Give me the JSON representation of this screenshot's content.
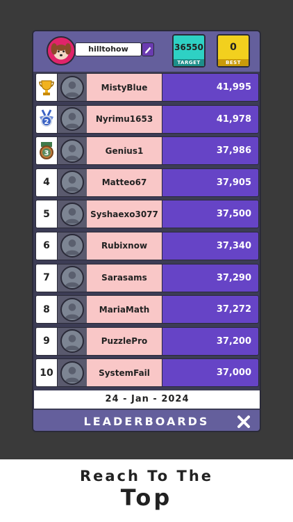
{
  "header": {
    "username": "hilltohow",
    "target_value": "36550",
    "target_label": "TARGET",
    "best_value": "0",
    "best_label": "BEST"
  },
  "leaderboard": [
    {
      "rank": "1",
      "rank_icon": "trophy-icon",
      "name": "MistyBlue",
      "score": "41,995"
    },
    {
      "rank": "2",
      "rank_icon": "silver-medal-icon",
      "name": "Nyrimu1653",
      "score": "41,978"
    },
    {
      "rank": "3",
      "rank_icon": "bronze-medal-icon",
      "name": "Genius1",
      "score": "37,986"
    },
    {
      "rank": "4",
      "name": "Matteo67",
      "score": "37,905"
    },
    {
      "rank": "5",
      "name": "Syshaexo3077",
      "score": "37,500"
    },
    {
      "rank": "6",
      "name": "Rubixnow",
      "score": "37,340"
    },
    {
      "rank": "7",
      "name": "Sarasams",
      "score": "37,290"
    },
    {
      "rank": "8",
      "name": "MariaMath",
      "score": "37,272"
    },
    {
      "rank": "9",
      "name": "PuzzlePro",
      "score": "37,200"
    },
    {
      "rank": "10",
      "name": "SystemFail",
      "score": "37,000"
    }
  ],
  "date": "24 - Jan - 2024",
  "footer": {
    "title": "LEADERBOARDS"
  },
  "tagline": {
    "line1": "Reach To The",
    "line2": "Top"
  },
  "colors": {
    "background": "#3a3a3a",
    "header": "#645f9c",
    "name_cell": "#f9c7c7",
    "score_cell": "#6644c6",
    "target": "#2ed1c4",
    "best": "#f2d01e"
  }
}
